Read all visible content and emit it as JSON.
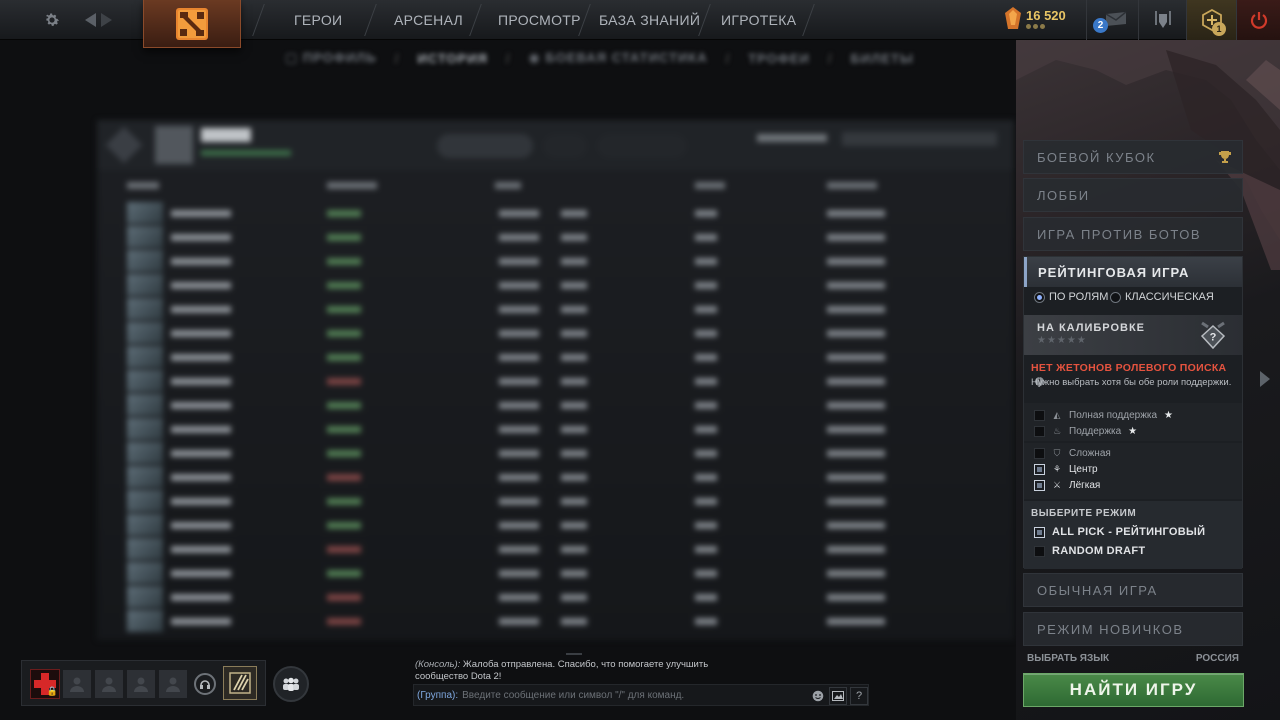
{
  "nav": {
    "items": [
      "ГЕРОИ",
      "АРСЕНАЛ",
      "ПРОСМОТР",
      "БАЗА ЗНАНИЙ",
      "ИГРОТЕКА"
    ]
  },
  "header": {
    "currency_value": "16 520",
    "notification_count": "2",
    "battle_badge": "1"
  },
  "profile_tabs": [
    "ПРОФИЛЬ",
    "ИСТОРИЯ",
    "БОЕВАЯ СТАТИСТИКА",
    "ТРОФЕИ",
    "БИЛЕТЫ"
  ],
  "play_menu": {
    "battle_cup": "БОЕВОЙ КУБОК",
    "lobby": "ЛОББИ",
    "vs_bots": "ИГРА ПРОТИВ БОТОВ",
    "ranked": {
      "title": "РЕЙТИНГОВАЯ ИГРА",
      "radio_roles": "ПО РОЛЯМ",
      "radio_classic": "КЛАССИЧЕСКАЯ",
      "calibration": "НА КАЛИБРОВКЕ",
      "calibration_stars": "★★★★★",
      "warning_title": "НЕТ ЖЕТОНОВ РОЛЕВОГО ПОИСКА",
      "warning_desc": "Нужно выбрать хотя бы обе роли поддержки.",
      "roles": [
        {
          "label": "Полная поддержка",
          "star": true,
          "checked": false
        },
        {
          "label": "Поддержка",
          "star": true,
          "checked": false
        },
        {
          "label": "Сложная",
          "star": false,
          "checked": false
        },
        {
          "label": "Центр",
          "star": false,
          "checked": true
        },
        {
          "label": "Лёгкая",
          "star": false,
          "checked": true
        }
      ],
      "mode_title": "ВЫБЕРИТЕ РЕЖИМ",
      "modes": [
        {
          "label": "ALL PICK - РЕЙТИНГОВЫЙ",
          "checked": true
        },
        {
          "label": "RANDOM DRAFT",
          "checked": false
        }
      ]
    },
    "normal": "ОБЫЧНАЯ ИГРА",
    "newbie": "РЕЖИМ НОВИЧКОВ",
    "language_label": "ВЫБРАТЬ ЯЗЫК",
    "language_value": "РОССИЯ",
    "find_game": "НАЙТИ ИГРУ"
  },
  "chat": {
    "message_source": "(Консоль):",
    "message_text": "Жалоба отправлена. Спасибо, что помогаете улучшить сообщество Dota 2!",
    "channel": "(Группа):",
    "placeholder": "Введите сообщение или символ \"/\" для команд.",
    "help": "?"
  },
  "colors": {
    "accent_orange": "#e8852f",
    "find_game_green": "#3c7d3d",
    "warning_red": "#e5533f",
    "gold": "#e8c565"
  }
}
